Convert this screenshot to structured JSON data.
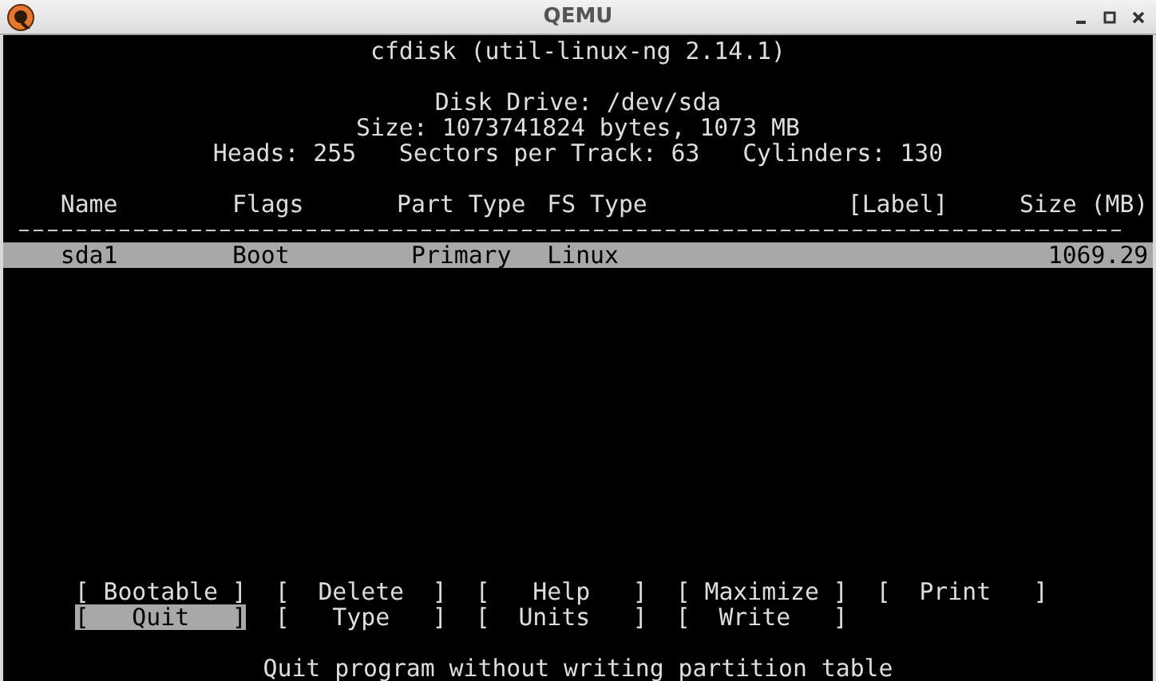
{
  "window": {
    "title": "QEMU"
  },
  "header": {
    "title": "cfdisk (util-linux-ng 2.14.1)",
    "disk_drive": "Disk Drive: /dev/sda",
    "size": "Size: 1073741824 bytes, 1073 MB",
    "geometry": "Heads: 255   Sectors per Track: 63   Cylinders: 130"
  },
  "table": {
    "columns": [
      "Name",
      "Flags",
      "Part Type",
      "FS Type",
      "[Label]",
      "Size (MB)"
    ],
    "rows": [
      {
        "selected": true,
        "name": "sda1",
        "flags": "Boot",
        "part_type": "Primary",
        "fs_type": "Linux",
        "size": "1069.29"
      }
    ]
  },
  "menu": [
    {
      "label": "[ Bootable ]",
      "selected": false
    },
    {
      "label": "[  Delete  ]",
      "selected": false
    },
    {
      "label": "[   Help   ]",
      "selected": false
    },
    {
      "label": "[ Maximize ]",
      "selected": false
    },
    {
      "label": "[  Print   ]",
      "selected": false
    },
    {
      "label": "[   Quit   ]",
      "selected": true
    },
    {
      "label": "[   Type   ]",
      "selected": false
    },
    {
      "label": "[  Units   ]",
      "selected": false
    },
    {
      "label": "[  Write   ]",
      "selected": false
    }
  ],
  "status_bar": "Quit program without writing partition table"
}
